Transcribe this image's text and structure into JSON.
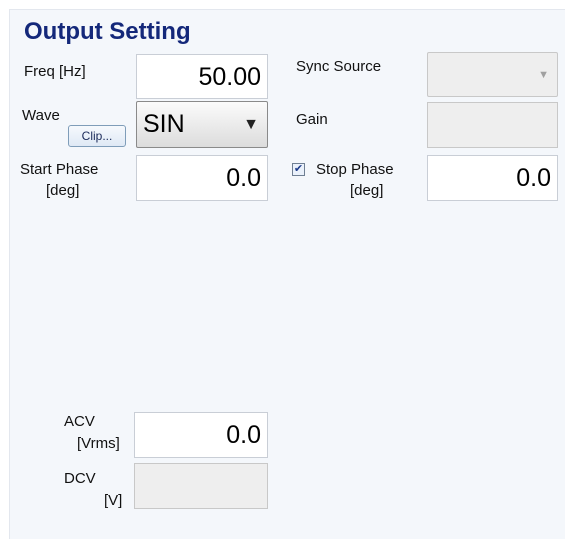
{
  "title": "Output Setting",
  "freq": {
    "label": "Freq [Hz]",
    "value": "50.00"
  },
  "sync": {
    "label": "Sync Source",
    "value": ""
  },
  "wave": {
    "label": "Wave",
    "clip_label": "Clip...",
    "value": "SIN"
  },
  "gain": {
    "label": "Gain",
    "value": ""
  },
  "start_phase": {
    "label_line1": "Start Phase",
    "label_line2": "[deg]",
    "value": "0.0"
  },
  "stop_phase": {
    "checked": true,
    "label_line1": "Stop Phase",
    "label_line2": "[deg]",
    "value": "0.0"
  },
  "acv": {
    "label_line1": "ACV",
    "label_line2": "[Vrms]",
    "value": "0.0"
  },
  "dcv": {
    "label_line1": "DCV",
    "label_line2": "[V]",
    "value": ""
  }
}
